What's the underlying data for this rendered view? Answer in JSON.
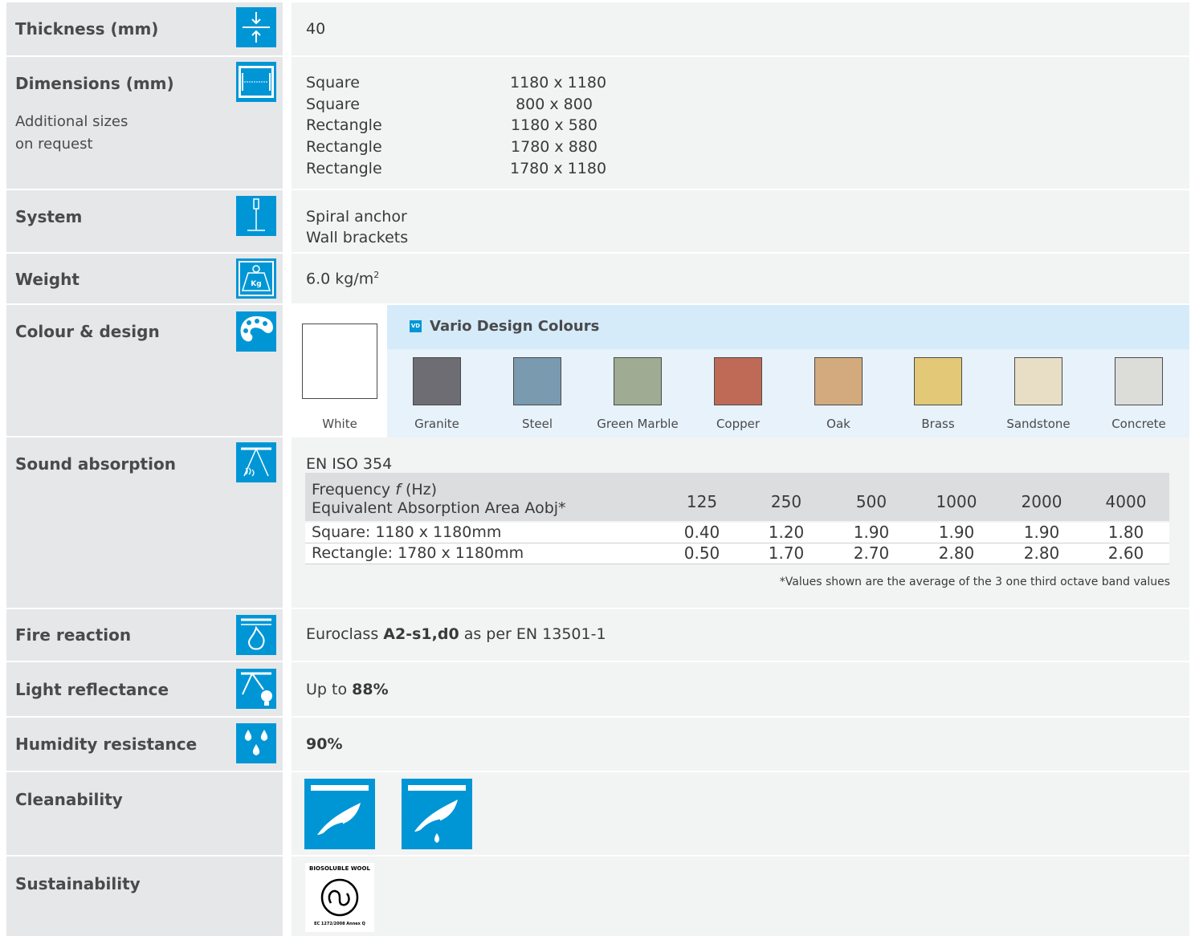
{
  "rows": {
    "thickness": {
      "label": "Thickness (mm)",
      "value": "40"
    },
    "dimensions": {
      "label": "Dimensions (mm)",
      "note_line1": "Additional sizes",
      "note_line2": "on request",
      "items": [
        {
          "shape": "Square",
          "size": "1180 x 1180"
        },
        {
          "shape": "Square",
          "size": "800 x 800"
        },
        {
          "shape": "Rectangle",
          "size": "1180 x 580"
        },
        {
          "shape": "Rectangle",
          "size": "1780 x 880"
        },
        {
          "shape": "Rectangle",
          "size": "1780 x 1180"
        }
      ]
    },
    "system": {
      "label": "System",
      "line1": "Spiral anchor",
      "line2": "Wall brackets"
    },
    "weight": {
      "label": "Weight",
      "value": "6.0 kg/m",
      "sup": "2"
    },
    "colour": {
      "label": "Colour & design",
      "white": "White",
      "vd_tag": "VD",
      "vd_title": "Vario Design Colours",
      "swatches": [
        {
          "name": "Granite",
          "color": "#6e6d73"
        },
        {
          "name": "Steel",
          "color": "#7a9ab0"
        },
        {
          "name": "Green Marble",
          "color": "#9fab93"
        },
        {
          "name": "Copper",
          "color": "#bf6a56"
        },
        {
          "name": "Oak",
          "color": "#d3aa7e"
        },
        {
          "name": "Brass",
          "color": "#e2c877"
        },
        {
          "name": "Sandstone",
          "color": "#e8dec6"
        },
        {
          "name": "Concrete",
          "color": "#dcdcd8"
        }
      ]
    },
    "sound": {
      "label": "Sound absorption",
      "standard": "EN ISO 354",
      "header_line1": "Frequency ",
      "header_f": "f",
      "header_line1b": " (Hz)",
      "header_line2": "Equivalent Absorption Area Aobj*",
      "frequencies": [
        "125",
        "250",
        "500",
        "1000",
        "2000",
        "4000"
      ],
      "rows": [
        {
          "name": "Square: 1180 x 1180mm",
          "values": [
            "0.40",
            "1.20",
            "1.90",
            "1.90",
            "1.90",
            "1.80"
          ]
        },
        {
          "name": "Rectangle: 1780 x 1180mm",
          "values": [
            "0.50",
            "1.70",
            "2.70",
            "2.80",
            "2.80",
            "2.60"
          ]
        }
      ],
      "footnote": "*Values shown are the average of the 3 one third octave band values"
    },
    "fire": {
      "label": "Fire reaction",
      "pre": "Euroclass ",
      "bold": "A2-s1,d0",
      "post": " as per EN 13501-1"
    },
    "light": {
      "label": "Light reflectance",
      "pre": "Up to ",
      "bold": "88%"
    },
    "humidity": {
      "label": "Humidity resistance",
      "bold": "90%"
    },
    "cleanability": {
      "label": "Cleanability"
    },
    "sustainability": {
      "label": "Sustainability",
      "badge_top": "BIOSOLUBLE WOOL",
      "badge_bottom": "EC 1272/2008 Annex Q"
    }
  },
  "accent_color": "#0096d6"
}
